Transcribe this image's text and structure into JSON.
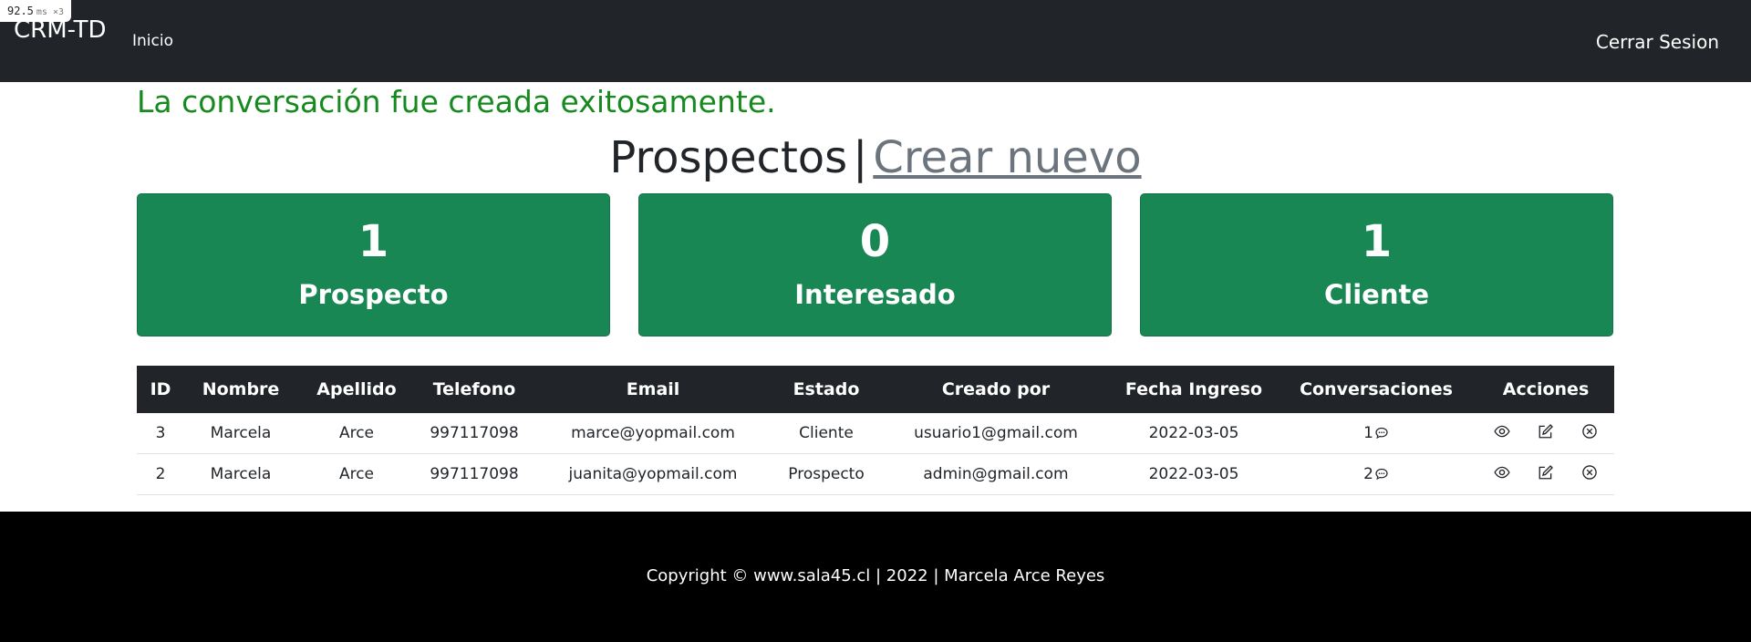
{
  "perf_badge": {
    "value": "92.5",
    "unit": "ms ×3"
  },
  "nav": {
    "brand": "CRM-TD",
    "home": "Inicio",
    "logout": "Cerrar Sesion"
  },
  "flash_message": "La conversación fue creada exitosamente.",
  "heading": {
    "title": "Prospectos",
    "separator": "|",
    "create_link": "Crear nuevo"
  },
  "stats": [
    {
      "count": "1",
      "label": "Prospecto"
    },
    {
      "count": "0",
      "label": "Interesado"
    },
    {
      "count": "1",
      "label": "Cliente"
    }
  ],
  "table": {
    "headers": [
      "ID",
      "Nombre",
      "Apellido",
      "Telefono",
      "Email",
      "Estado",
      "Creado por",
      "Fecha Ingreso",
      "Conversaciones",
      "Acciones"
    ],
    "rows": [
      {
        "id": "3",
        "nombre": "Marcela",
        "apellido": "Arce",
        "telefono": "997117098",
        "email": "marce@yopmail.com",
        "estado": "Cliente",
        "creado_por": "usuario1@gmail.com",
        "fecha": "2022-03-05",
        "conversaciones": "1"
      },
      {
        "id": "2",
        "nombre": "Marcela",
        "apellido": "Arce",
        "telefono": "997117098",
        "email": "juanita@yopmail.com",
        "estado": "Prospecto",
        "creado_por": "admin@gmail.com",
        "fecha": "2022-03-05",
        "conversaciones": "2"
      }
    ],
    "action_icons": [
      "eye-icon",
      "edit-icon",
      "delete-icon"
    ],
    "conversation_icon": "chat-bubble-icon"
  },
  "footer": {
    "text": "Copyright © www.sala45.cl | 2022 | Marcela Arce Reyes"
  },
  "colors": {
    "navbar": "#212529",
    "card": "#198754",
    "flash": "#168a1e",
    "footer": "#000000",
    "link": "#6c757d"
  }
}
